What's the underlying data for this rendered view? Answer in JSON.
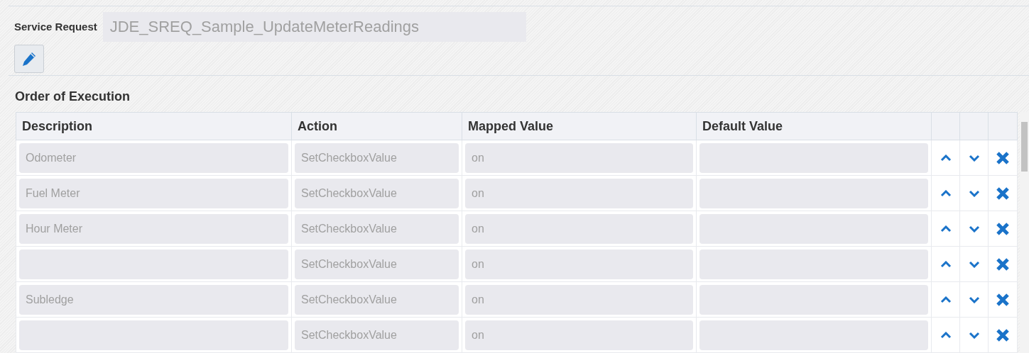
{
  "service_request": {
    "label": "Service Request",
    "value": "JDE_SREQ_Sample_UpdateMeterReadings"
  },
  "section_title": "Order of Execution",
  "table": {
    "columns": [
      "Description",
      "Action",
      "Mapped Value",
      "Default Value"
    ],
    "rows": [
      {
        "description": "Odometer",
        "action": "SetCheckboxValue",
        "mapped_value": "on"
      },
      {
        "description": "Fuel Meter",
        "action": "SetCheckboxValue",
        "mapped_value": "on"
      },
      {
        "description": "Hour Meter",
        "action": "SetCheckboxValue",
        "mapped_value": "on"
      },
      {
        "action": "SetCheckboxValue",
        "mapped_value": "on"
      },
      {
        "description": "Subledge",
        "action": "SetCheckboxValue",
        "mapped_value": "on"
      },
      {
        "action": "SetCheckboxValue",
        "mapped_value": "on"
      }
    ]
  }
}
